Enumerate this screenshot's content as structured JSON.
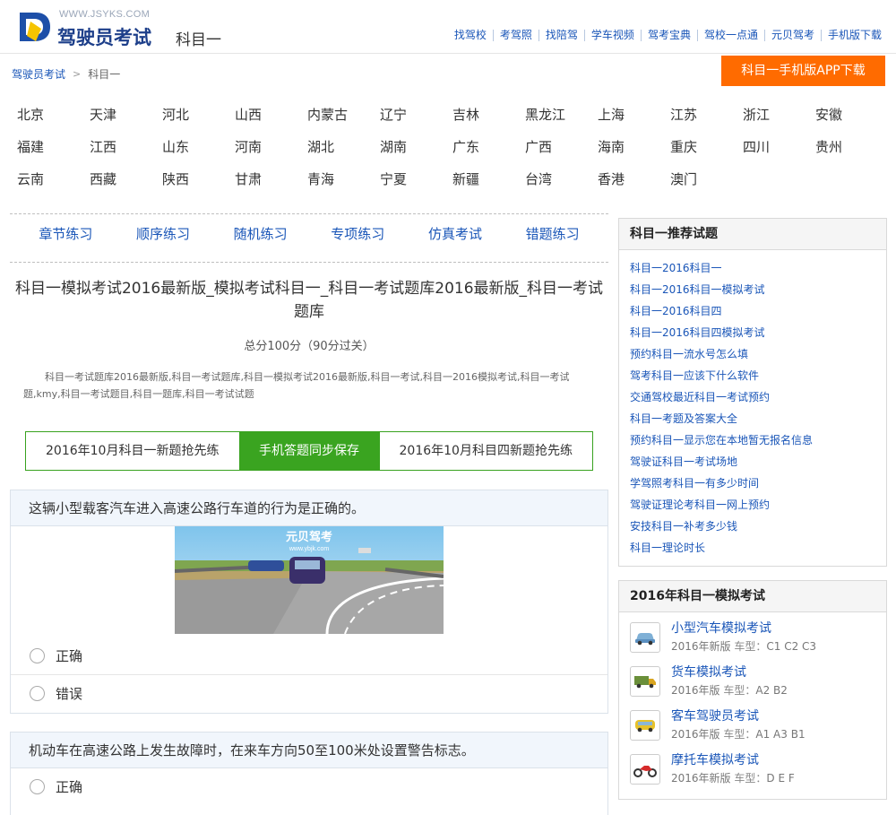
{
  "header": {
    "site_url": "WWW.JSYKS.COM",
    "site_title": "驾驶员考试",
    "subject": "科目一",
    "nav": [
      "找驾校",
      "考驾照",
      "找陪驾",
      "学车视频",
      "驾考宝典",
      "驾校一点通",
      "元贝驾考",
      "手机版下载"
    ]
  },
  "breadcrumb": {
    "home": "驾驶员考试",
    "current": "科目一"
  },
  "download_button": "科目一手机版APP下载",
  "provinces": [
    "北京",
    "天津",
    "河北",
    "山西",
    "内蒙古",
    "辽宁",
    "吉林",
    "黑龙江",
    "上海",
    "江苏",
    "浙江",
    "安徽",
    "福建",
    "江西",
    "山东",
    "河南",
    "湖北",
    "湖南",
    "广东",
    "广西",
    "海南",
    "重庆",
    "四川",
    "贵州",
    "云南",
    "西藏",
    "陕西",
    "甘肃",
    "青海",
    "宁夏",
    "新疆",
    "台湾",
    "香港",
    "澳门"
  ],
  "modes": [
    "章节练习",
    "顺序练习",
    "随机练习",
    "专项练习",
    "仿真考试",
    "错题练习"
  ],
  "test": {
    "title": "科目一模拟考试2016最新版_模拟考试科目一_科目一考试题库2016最新版_科目一考试题库",
    "score": "总分100分（90分过关）",
    "keywords": "科目一考试题库2016最新版,科目一考试题库,科目一模拟考试2016最新版,科目一考试,科目一2016模拟考试,科目一考试题,kmy,科目一考试题目,科目一题库,科目一考试试题"
  },
  "tabs": [
    "2016年10月科目一新题抢先练",
    "手机答题同步保存",
    "2016年10月科目四新题抢先练"
  ],
  "questions": [
    {
      "text": "这辆小型载客汽车进入高速公路行车道的行为是正确的。",
      "image_watermark": "元贝驾考",
      "image_url_text": "www.ybjk.com",
      "options": [
        "正确",
        "错误"
      ]
    },
    {
      "text": "机动车在高速公路上发生故障时，在来车方向50至100米处设置警告标志。",
      "options": [
        "正确"
      ]
    }
  ],
  "recommended": {
    "title": "科目一推荐试题",
    "items": [
      "科目一2016科目一",
      "科目一2016科目一模拟考试",
      "科目一2016科目四",
      "科目一2016科目四模拟考试",
      "预约科目一流水号怎么填",
      "驾考科目一应该下什么软件",
      "交通驾校最近科目一考试预约",
      "科目一考题及答案大全",
      "预约科目一显示您在本地暂无报名信息",
      "驾驶证科目一考试场地",
      "学驾照考科目一有多少时间",
      "驾驶证理论考科目一网上预约",
      "安技科目一补考多少钱",
      "科目一理论时长"
    ]
  },
  "simulations": {
    "title": "2016年科目一模拟考试",
    "type_label": "车型：",
    "items": [
      {
        "name": "小型汽车模拟考试",
        "edition": "2016年新版",
        "types": "C1 C2 C3",
        "icon": "car-icon"
      },
      {
        "name": "货车模拟考试",
        "edition": "2016年版",
        "types": "A2 B2",
        "icon": "truck-icon"
      },
      {
        "name": "客车驾驶员考试",
        "edition": "2016年版",
        "types": "A1 A3 B1",
        "icon": "bus-icon"
      },
      {
        "name": "摩托车模拟考试",
        "edition": "2016年新版",
        "types": "D E F",
        "icon": "motorcycle-icon"
      }
    ]
  },
  "colors": {
    "brand_blue": "#1d3f8a",
    "link_blue": "#1a56b8",
    "accent_orange": "#ff6b00",
    "green": "#3aa420"
  }
}
